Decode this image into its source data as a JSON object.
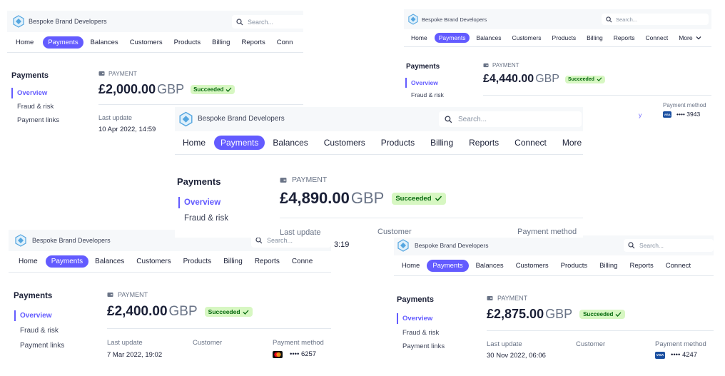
{
  "brand_name": "Bespoke Brand Developers",
  "search_placeholder": "Search...",
  "nav": {
    "home": "Home",
    "payments": "Payments",
    "balances": "Balances",
    "customers": "Customers",
    "products": "Products",
    "billing": "Billing",
    "reports": "Reports",
    "connect": "Connect",
    "more": "More",
    "connect_clipped": "Conn",
    "connect_clipped2": "Conne"
  },
  "side": {
    "title": "Payments",
    "overview": "Overview",
    "fraud": "Fraud & risk",
    "links": "Payment links"
  },
  "labels": {
    "payment": "PAYMENT",
    "last_update": "Last update",
    "customer": "Customer",
    "payment_method": "Payment method",
    "last_update_partial": "Last update",
    "customer_partial": "Customer"
  },
  "status": "Succeeded",
  "currency": "GBP",
  "panels": [
    {
      "amount": "£2,000.00",
      "last_update": "10 Apr 2022, 14:59"
    },
    {
      "amount": "£4,440.00",
      "card_last4": "•••• 3943",
      "customer_clipped": "y"
    },
    {
      "amount": "£4,890.00",
      "time_clipped": "3:19"
    },
    {
      "amount": "£2,400.00",
      "last_update": "7 Mar 2022, 19:02",
      "card_last4": "•••• 6257"
    },
    {
      "amount": "£2,875.00",
      "last_update": "30 Nov 2022, 06:06",
      "card_last4": "•••• 4247"
    }
  ],
  "colors": {
    "accent": "#635bff",
    "badge_bg": "#d7f7c2",
    "badge_fg": "#05690d",
    "topbar_bg": "#f6f8fa"
  },
  "icons": {
    "logo": "cube-logo-icon",
    "search": "search-icon",
    "payment": "wallet-icon",
    "check": "check-icon",
    "chevron": "chevron-down-icon"
  }
}
